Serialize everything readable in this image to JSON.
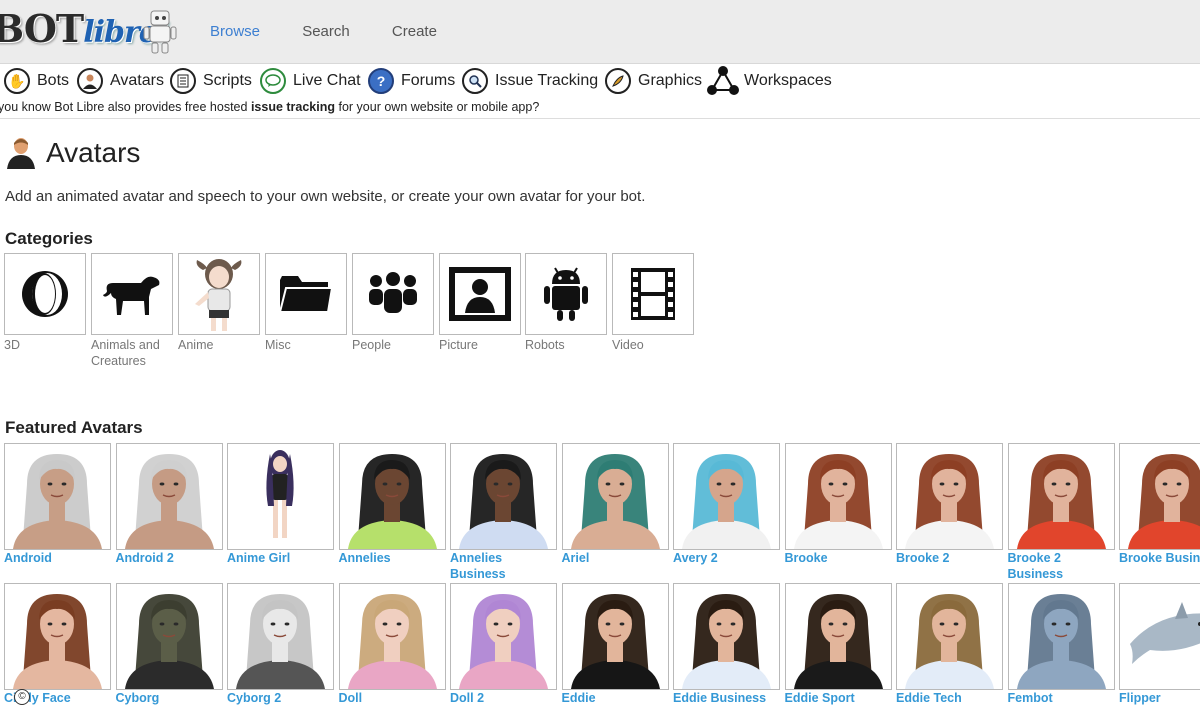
{
  "header": {
    "logo_bot": "BOT",
    "logo_libre": "libre!",
    "nav": [
      "Browse",
      "Search",
      "Create"
    ],
    "active": "Browse"
  },
  "subnav": [
    {
      "label": "Bots",
      "icon": "bots-icon"
    },
    {
      "label": "Avatars",
      "icon": "avatars-icon"
    },
    {
      "label": "Scripts",
      "icon": "scripts-icon"
    },
    {
      "label": "Live Chat",
      "icon": "live-chat-icon"
    },
    {
      "label": "Forums",
      "icon": "forums-icon"
    },
    {
      "label": "Issue Tracking",
      "icon": "issue-tracking-icon"
    },
    {
      "label": "Graphics",
      "icon": "graphics-icon"
    },
    {
      "label": "Workspaces",
      "icon": "workspaces-icon"
    }
  ],
  "notice": {
    "before": "you know Bot Libre also provides free hosted ",
    "bold": "issue tracking",
    "after": " for your own website or mobile app?"
  },
  "page": {
    "title": "Avatars",
    "description": "Add an animated avatar and speech to your own website, or create your own avatar for your bot.",
    "categories_heading": "Categories",
    "featured_heading": "Featured Avatars"
  },
  "categories": [
    {
      "label": "3D",
      "icon": "3d-icon"
    },
    {
      "label": "Animals and Creatures",
      "icon": "dog-icon"
    },
    {
      "label": "Anime",
      "icon": "anime-girl-icon"
    },
    {
      "label": "Misc",
      "icon": "folder-icon"
    },
    {
      "label": "People",
      "icon": "people-icon"
    },
    {
      "label": "Picture",
      "icon": "picture-icon"
    },
    {
      "label": "Robots",
      "icon": "android-icon"
    },
    {
      "label": "Video",
      "icon": "film-icon"
    }
  ],
  "featured_row1": [
    {
      "name": "Android",
      "skin": "#c79e86",
      "hair": "#c9c9c9",
      "shirt": "#c79e86"
    },
    {
      "name": "Android 2",
      "skin": "#c59b84",
      "hair": "#cfcfcf",
      "shirt": "#c59b84"
    },
    {
      "name": "Anime Girl",
      "skin": "#f2d5c4",
      "hair": "#3a2f5e",
      "shirt": "#222222"
    },
    {
      "name": "Annelies",
      "skin": "#6b4632",
      "hair": "#1a1a1a",
      "shirt": "#b6e06b"
    },
    {
      "name": "Annelies Business",
      "skin": "#6b4632",
      "hair": "#1a1a1a",
      "shirt": "#cfdcf2"
    },
    {
      "name": "Ariel",
      "skin": "#d9ad94",
      "hair": "#2e7d74",
      "shirt": "#d9ad94"
    },
    {
      "name": "Avery 2",
      "skin": "#d5a58c",
      "hair": "#58b9d6",
      "shirt": "#f1f1f1"
    },
    {
      "name": "Brooke",
      "skin": "#e1b39c",
      "hair": "#8d3f24",
      "shirt": "#f4f4f4"
    },
    {
      "name": "Brooke 2",
      "skin": "#e1b39c",
      "hair": "#8d3f24",
      "shirt": "#f4f4f4"
    },
    {
      "name": "Brooke 2 Business",
      "skin": "#e1b39c",
      "hair": "#8d3f24",
      "shirt": "#e1452c"
    },
    {
      "name": "Brooke Business",
      "skin": "#e1b39c",
      "hair": "#8d3f24",
      "shirt": "#e1452c"
    }
  ],
  "featured_row2": [
    {
      "name": "Cindy Face",
      "skin": "#e4b7a0",
      "hair": "#7a3d22",
      "shirt": "#e4b7a0"
    },
    {
      "name": "Cyborg",
      "skin": "#5b5e48",
      "hair": "#3c3e30",
      "shirt": "#2b2b2b"
    },
    {
      "name": "Cyborg 2",
      "skin": "#e8e8e8",
      "hair": "#c4c4c4",
      "shirt": "#555555"
    },
    {
      "name": "Doll",
      "skin": "#f0cfc0",
      "hair": "#c9a778",
      "shirt": "#e9a6c5"
    },
    {
      "name": "Doll 2",
      "skin": "#f0cfc0",
      "hair": "#b086d4",
      "shirt": "#e9a6c5"
    },
    {
      "name": "Eddie",
      "skin": "#e2b59b",
      "hair": "#2a1c12",
      "shirt": "#161616"
    },
    {
      "name": "Eddie Business",
      "skin": "#e2b59b",
      "hair": "#2a1c12",
      "shirt": "#e3ecf8"
    },
    {
      "name": "Eddie Sport",
      "skin": "#e2b59b",
      "hair": "#2a1c12",
      "shirt": "#1a1a1a"
    },
    {
      "name": "Eddie Tech",
      "skin": "#e2b59b",
      "hair": "#8a6a3c",
      "shirt": "#e3ecf8"
    },
    {
      "name": "Fembot",
      "skin": "#8ea6c0",
      "hair": "#62788f",
      "shirt": "#8ea6c0"
    },
    {
      "name": "Flipper",
      "skin": "#a9b8c6",
      "hair": "#a9b8c6",
      "shirt": "#a9b8c6"
    }
  ]
}
